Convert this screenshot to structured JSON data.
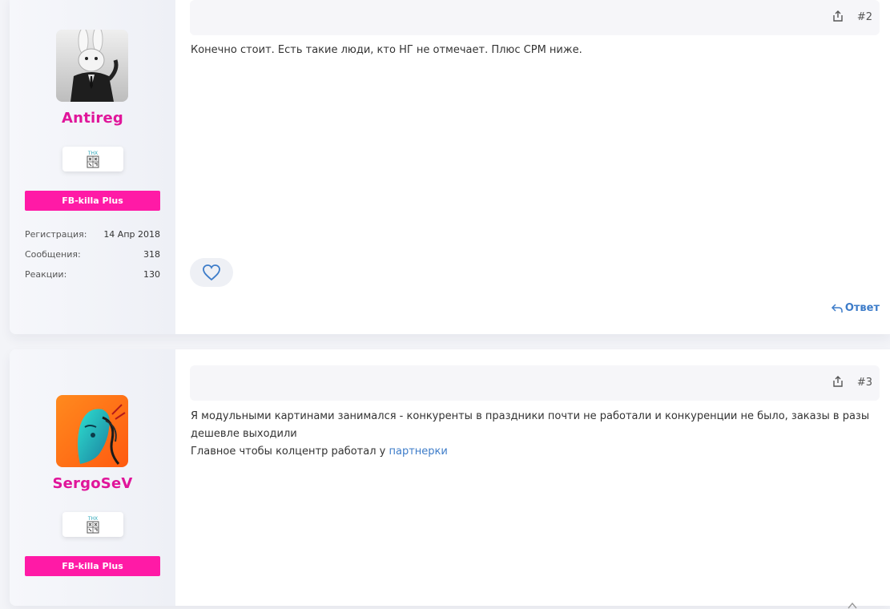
{
  "posts": [
    {
      "user": {
        "name": "Antireg",
        "thx_label": "THX",
        "role": "FB-killa Plus",
        "stats": [
          {
            "label": "Регистрация:",
            "value": "14 Апр 2018"
          },
          {
            "label": "Сообщения:",
            "value": "318"
          },
          {
            "label": "Реакции:",
            "value": "130"
          }
        ]
      },
      "number": "#2",
      "text": "Конечно стоит. Есть такие люди, кто НГ не отмечает. Плюс CPM ниже.",
      "reply_label": "Ответ"
    },
    {
      "user": {
        "name": "SergoSeV",
        "thx_label": "THX",
        "role": "FB-killa Plus"
      },
      "number": "#3",
      "text_line1": "Я модульными картинами занимался - конкуренты в праздники почти не работали и конкуренции не было, заказы в разы дешевле выходили",
      "text_line2_prefix": "Главное чтобы колцентр работал у ",
      "text_link": "партнерки"
    }
  ],
  "colors": {
    "username": "#e0159a",
    "role_banner": "#ff1aa6",
    "link": "#3d7cc9"
  },
  "icons": [
    "share-icon",
    "heart-icon",
    "reply-icon",
    "thx-icon",
    "scroll-up-icon"
  ]
}
